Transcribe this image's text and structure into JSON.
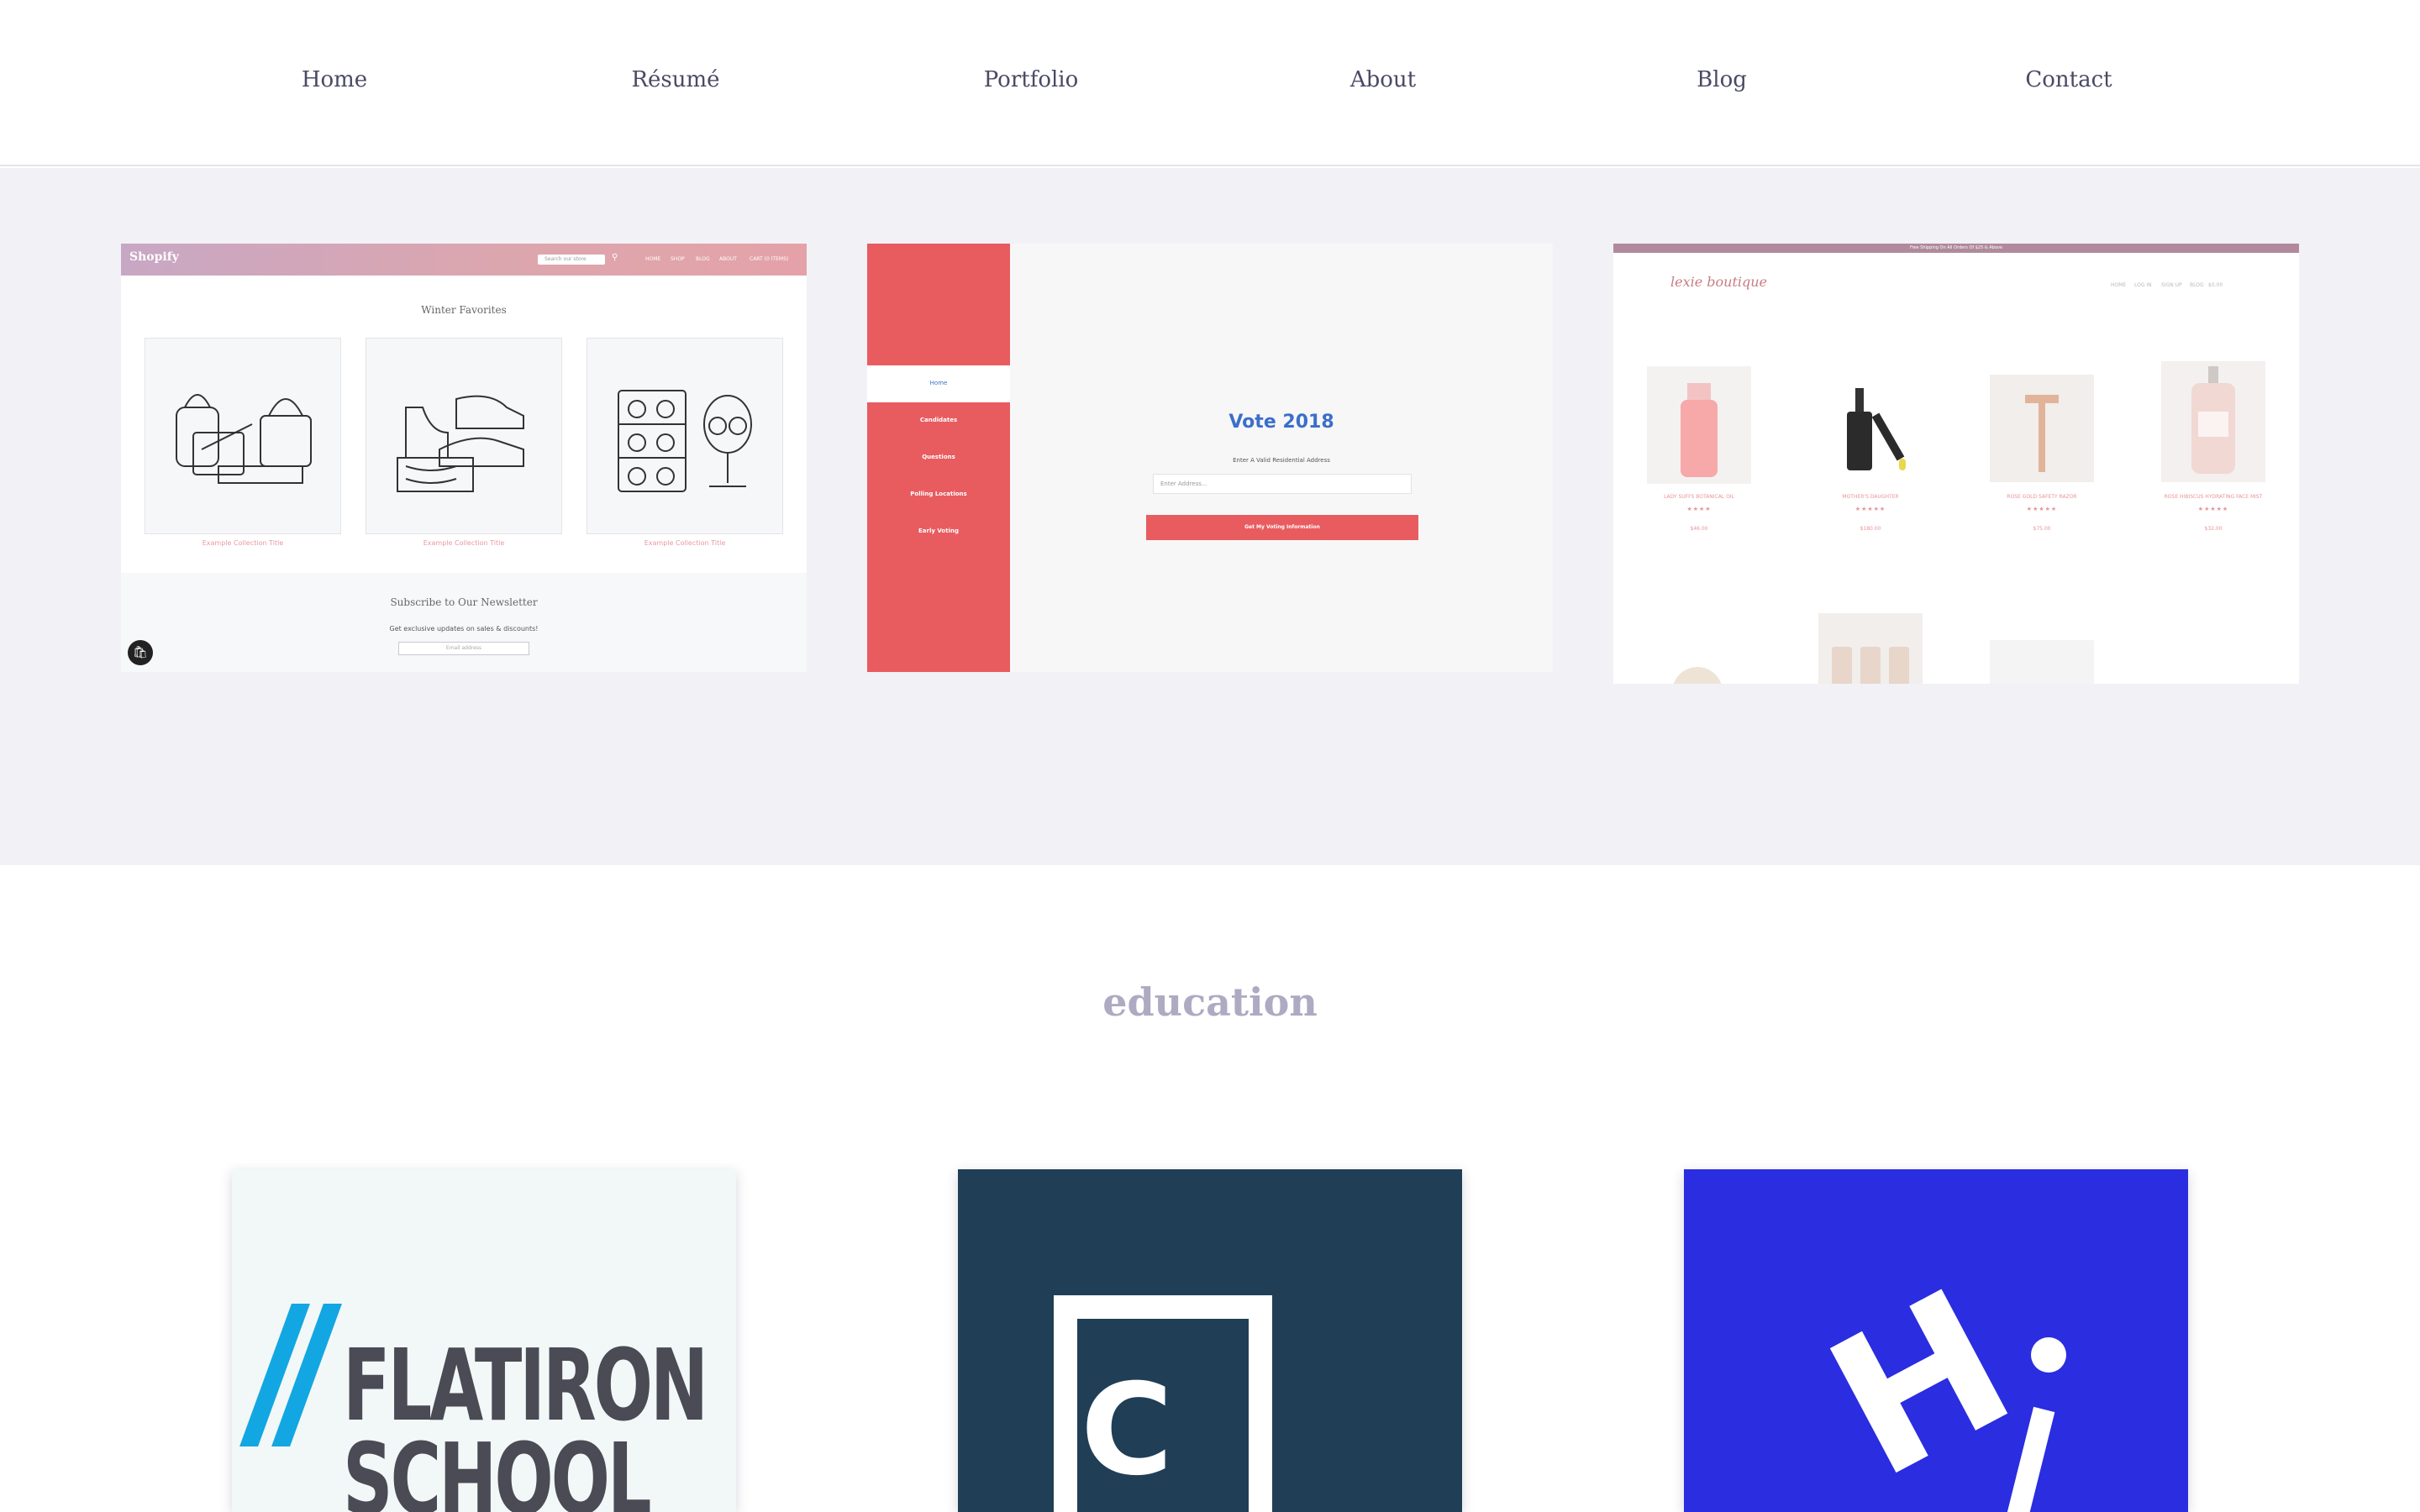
{
  "nav": {
    "links": [
      "Home",
      "Résumé",
      "Portfolio",
      "About",
      "Blog",
      "Contact"
    ]
  },
  "portfolio": {
    "shopify": {
      "logo": "Shopify",
      "search_placeholder": "Search our store",
      "menu": [
        "HOME",
        "SHOP",
        "BLOG",
        "ABOUT",
        "CART (0 ITEMS)"
      ],
      "section_title": "Winter Favorites",
      "collections": [
        "Example Collection Title",
        "Example Collection Title",
        "Example Collection Title"
      ],
      "newsletter_title": "Subscribe to Our Newsletter",
      "newsletter_sub": "Get exclusive updates on sales & discounts!",
      "email_placeholder": "Email address"
    },
    "vote": {
      "sidebar": [
        "Home",
        "Candidates",
        "Questions",
        "Polling Locations",
        "Early Voting"
      ],
      "title": "Vote 2018",
      "label": "Enter A Valid Residential Address",
      "input_placeholder": "Enter Address...",
      "button": "Get My Voting Information"
    },
    "boutique": {
      "banner": "Free Shipping On All Orders Of $25 & Above",
      "logo": "lexie boutique",
      "menu": [
        "HOME",
        "LOG IN",
        "SIGN UP",
        "BLOG",
        "$0.00"
      ],
      "products": [
        {
          "name": "LADY SUFFS BOTANICAL OIL",
          "stars": "★★★★",
          "price": "$46.00"
        },
        {
          "name": "MOTHER'S DAUGHTER",
          "stars": "★★★★★",
          "price": "$180.00"
        },
        {
          "name": "ROSE GOLD SAFETY RAZOR",
          "stars": "★★★★★",
          "price": "$75.00"
        },
        {
          "name": "ROSE HIBISCUS HYDRATING FACE MIST",
          "stars": "★★★★★",
          "price": "$32.00"
        }
      ]
    }
  },
  "education": {
    "title": "education",
    "schools": [
      {
        "name": "Flatiron School",
        "lines": [
          "FLATIRON",
          "SCHOOL"
        ]
      },
      {
        "name": "Codecademy",
        "letter": "C"
      },
      {
        "name": "Hyper Island",
        "letter": "H"
      }
    ]
  },
  "colors": {
    "nav_text": "#4a4a66",
    "band_bg": "#f2f1f6",
    "education_title": "#aeaac2",
    "vote_red": "#e85c60",
    "vote_blue": "#3b6fc9",
    "codecademy_bg": "#203f56",
    "hyper_bg": "#2a2de0",
    "flatiron_blue": "#12a7e2"
  }
}
